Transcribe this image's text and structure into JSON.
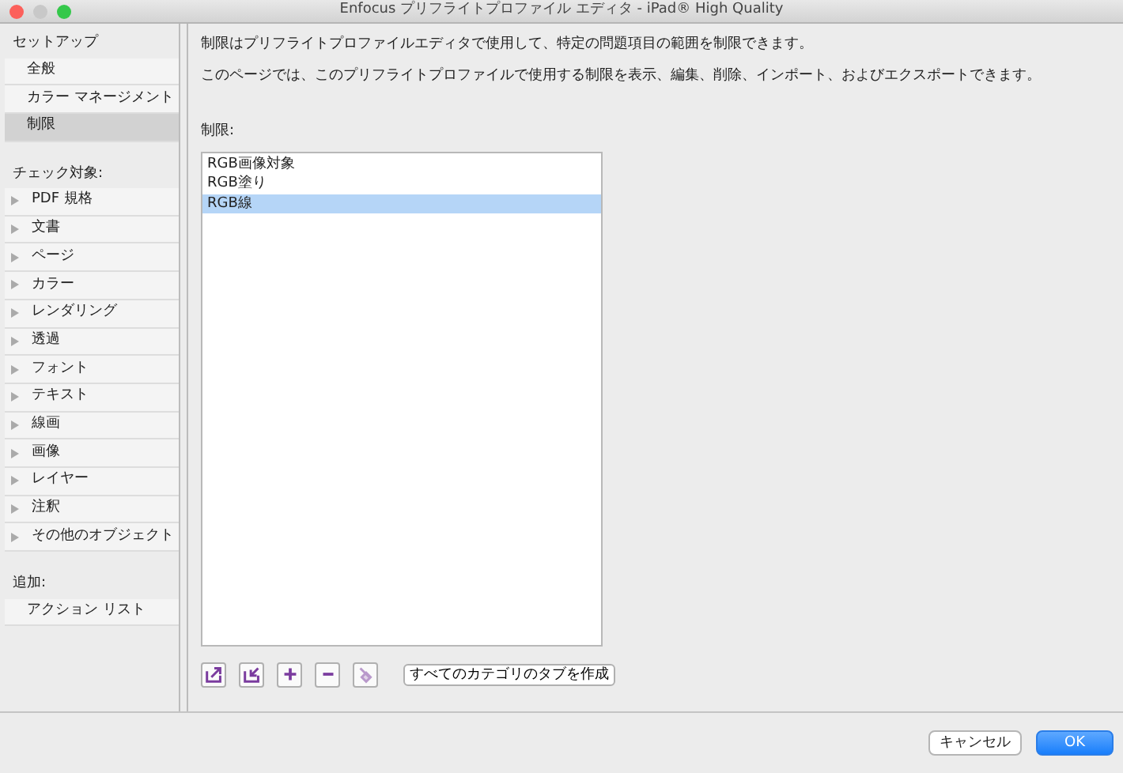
{
  "window": {
    "title": "Enfocus プリフライトプロファイル エディタ - iPad® High Quality"
  },
  "sidebar": {
    "sections": [
      {
        "heading": "セットアップ",
        "items": [
          {
            "label": "全般",
            "selected": false,
            "kind": "plain"
          },
          {
            "label": "カラー マネージメント",
            "selected": false,
            "kind": "plain"
          },
          {
            "label": "制限",
            "selected": true,
            "kind": "plain"
          }
        ]
      },
      {
        "heading": "チェック対象:",
        "items": [
          {
            "label": "PDF 規格",
            "selected": false,
            "kind": "group",
            "expanded": false
          },
          {
            "label": "文書",
            "selected": false,
            "kind": "group",
            "expanded": false
          },
          {
            "label": "ページ",
            "selected": false,
            "kind": "group",
            "expanded": false
          },
          {
            "label": "カラー",
            "selected": false,
            "kind": "group",
            "expanded": false
          },
          {
            "label": "レンダリング",
            "selected": false,
            "kind": "group",
            "expanded": false
          },
          {
            "label": "透過",
            "selected": false,
            "kind": "group",
            "expanded": false
          },
          {
            "label": "フォント",
            "selected": false,
            "kind": "group",
            "expanded": false
          },
          {
            "label": "テキスト",
            "selected": false,
            "kind": "group",
            "expanded": false
          },
          {
            "label": "線画",
            "selected": false,
            "kind": "group",
            "expanded": false
          },
          {
            "label": "画像",
            "selected": false,
            "kind": "group",
            "expanded": false
          },
          {
            "label": "レイヤー",
            "selected": false,
            "kind": "group",
            "expanded": false
          },
          {
            "label": "注釈",
            "selected": false,
            "kind": "group",
            "expanded": false
          },
          {
            "label": "その他のオブジェクト",
            "selected": false,
            "kind": "group",
            "expanded": false
          }
        ]
      },
      {
        "heading": "追加:",
        "items": [
          {
            "label": "アクション リスト",
            "selected": false,
            "kind": "plain"
          }
        ]
      }
    ]
  },
  "main": {
    "description": [
      "制限はプリフライトプロファイルエディタで使用して、特定の問題項目の範囲を制限できます。",
      "このページでは、このプリフライトプロファイルで使用する制限を表示、編集、削除、インポート、およびエクスポートできます。"
    ],
    "list_label": "制限:",
    "restrictions": [
      {
        "label": "RGB画像対象",
        "selected": false
      },
      {
        "label": "RGB塗り",
        "selected": false
      },
      {
        "label": "RGB線",
        "selected": true
      }
    ],
    "toolbar": [
      {
        "kind": "export",
        "disabled": false
      },
      {
        "kind": "import",
        "disabled": false
      },
      {
        "kind": "add",
        "disabled": false
      },
      {
        "kind": "remove",
        "disabled": false
      },
      {
        "kind": "brush",
        "disabled": true
      }
    ],
    "tab_button": "すべてのカテゴリのタブを作成"
  },
  "buttons": [
    {
      "label": "キャンセル",
      "kind": "default"
    },
    {
      "label": "OK",
      "kind": "primary"
    }
  ]
}
